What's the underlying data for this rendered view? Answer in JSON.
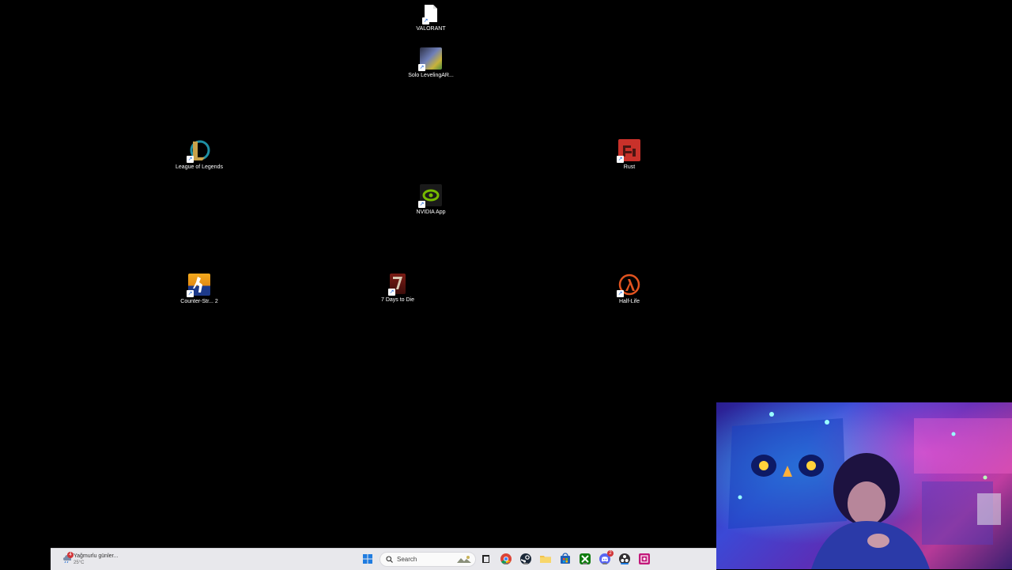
{
  "desktop": {
    "icons": [
      {
        "label": "VALORANT",
        "icon": "document-icon"
      },
      {
        "label": "Solo LevelingAR...",
        "icon": "solo-leveling-icon"
      },
      {
        "label": "League of Legends",
        "icon": "league-of-legends-icon"
      },
      {
        "label": "Rust",
        "icon": "rust-icon"
      },
      {
        "label": "NVIDIA App",
        "icon": "nvidia-icon"
      },
      {
        "label": "Counter-Str... 2",
        "icon": "counter-strike-icon"
      },
      {
        "label": "7 Days to Die",
        "icon": "seven-days-to-die-icon"
      },
      {
        "label": "Half-Life",
        "icon": "half-life-icon"
      }
    ]
  },
  "taskbar": {
    "weather": {
      "text": "Yağmurlu günler...",
      "temp": "25°C",
      "badge": "4"
    },
    "search_placeholder": "Search",
    "apps": [
      "start-icon",
      "task-view-icon",
      "chrome-icon",
      "steam-icon",
      "file-explorer-icon",
      "store-icon",
      "xbox-icon",
      "discord-icon",
      "obs-icon",
      "photo-app-icon"
    ],
    "discord_badge": "2"
  },
  "webcam": {
    "description_icon": "webcam-overlay"
  }
}
